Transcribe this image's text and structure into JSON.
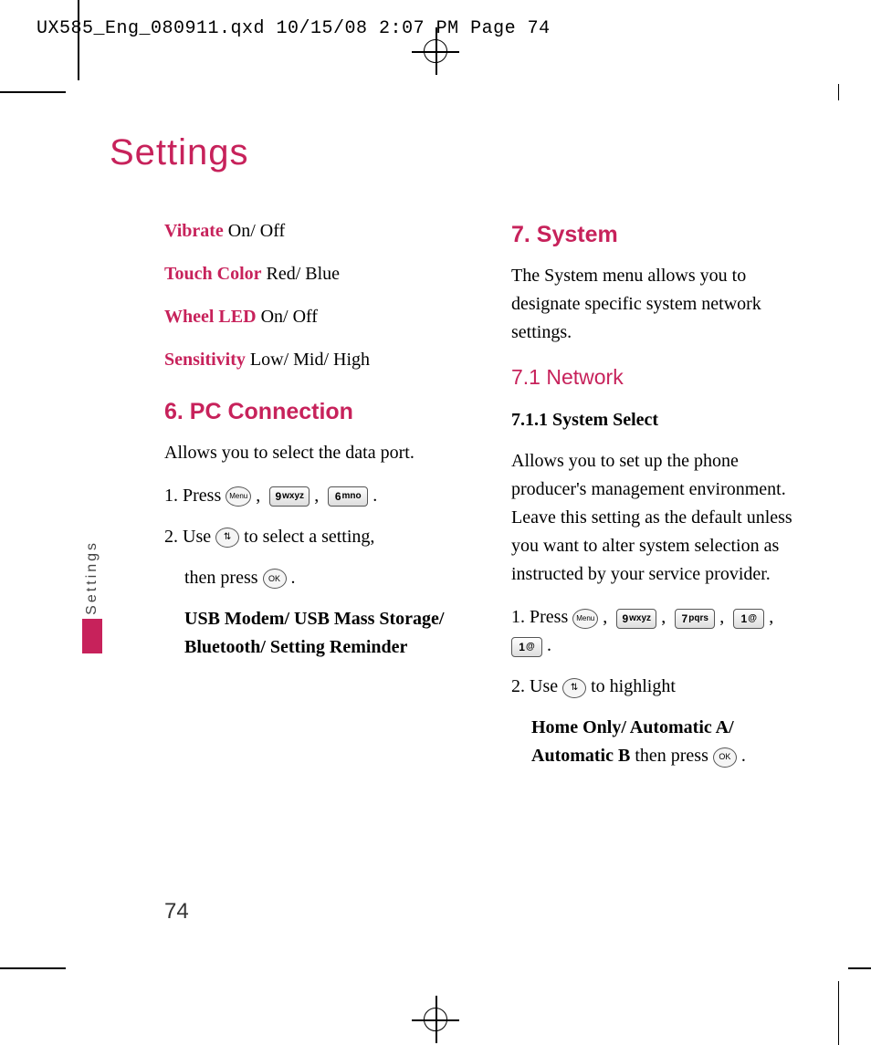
{
  "header": "UX585_Eng_080911.qxd  10/15/08  2:07 PM  Page 74",
  "pageTitle": "Settings",
  "sideLabel": "Settings",
  "pageNumber": "74",
  "left": {
    "opt1_label": "Vibrate",
    "opt1_vals": " On/ Off",
    "opt2_label": "Touch Color",
    "opt2_vals": " Red/ Blue",
    "opt3_label": "Wheel LED",
    "opt3_vals": " On/ Off",
    "opt4_label": "Sensitivity",
    "opt4_vals": " Low/ Mid/ High",
    "h6": "6. PC Connection",
    "p6": "Allows you to select the data port.",
    "s1a": "1. Press ",
    "s2a": "2. Use ",
    "s2b": " to select a setting,",
    "s2c": "then press ",
    "s3": "USB Modem/ USB Mass Storage/ Bluetooth/ Setting Reminder"
  },
  "right": {
    "h7": "7. System",
    "p7": "The System menu allows you to designate specific system network settings.",
    "h71": "7.1 Network",
    "h711": "7.1.1 System Select",
    "p711": "Allows you to set up the phone producer's management environment. Leave this setting as the default unless you want to alter system selection as instructed by your service provider.",
    "s1a": "1. Press ",
    "s2a": "2. Use ",
    "s2b": " to highlight",
    "s2c_bold": "Home Only/ Automatic A/ Automatic B",
    "s2c_tail": " then press "
  },
  "keys": {
    "menu": "Menu",
    "ok": "OK",
    "nav": "⇅",
    "k9": "9",
    "k9t": "wxyz",
    "k6": "6",
    "k6t": "mno",
    "k7": "7",
    "k7t": "pqrs",
    "k1": "1",
    "k1t": "@"
  }
}
